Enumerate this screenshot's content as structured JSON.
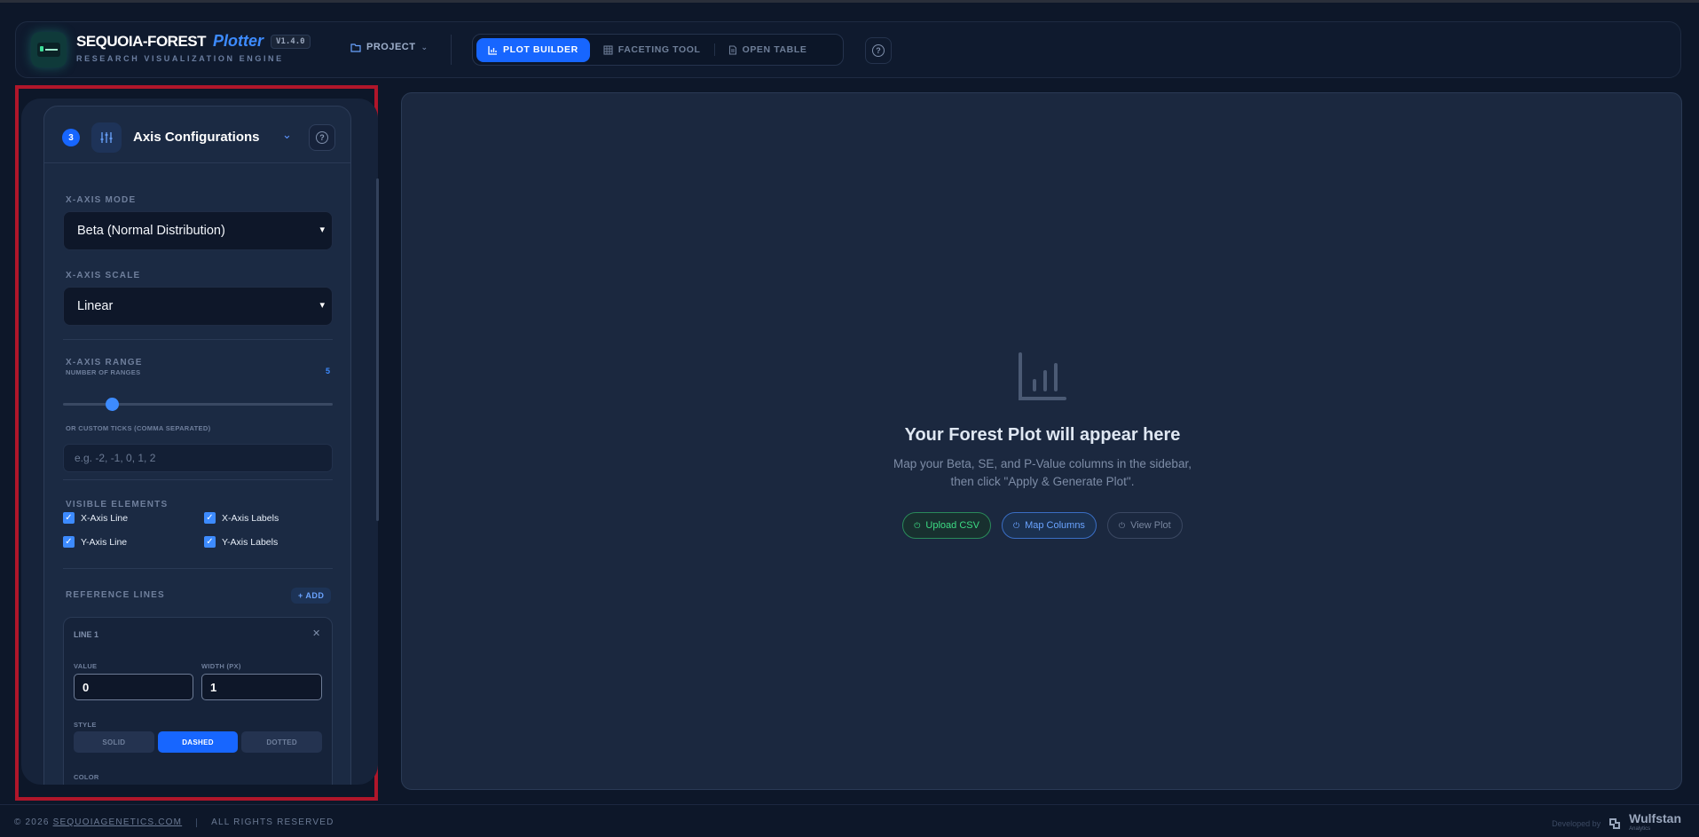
{
  "header": {
    "brand_name": "SEQUOIA-FOREST",
    "brand_sub": "Plotter",
    "version": "V1.4.0",
    "tagline": "RESEARCH VISUALIZATION ENGINE",
    "project_label": "PROJECT",
    "tabs": [
      {
        "label": "PLOT BUILDER",
        "icon": "bar-chart-icon",
        "active": true
      },
      {
        "label": "FACETING TOOL",
        "icon": "grid-icon",
        "active": false
      },
      {
        "label": "OPEN TABLE",
        "icon": "document-icon",
        "active": false
      }
    ]
  },
  "sidebar": {
    "step_number": "3",
    "section_title": "Axis Configurations",
    "x_axis_mode": {
      "label": "X-AXIS MODE",
      "value": "Beta (Normal Distribution)"
    },
    "x_axis_scale": {
      "label": "X-AXIS SCALE",
      "value": "Linear"
    },
    "x_axis_range": {
      "label": "X-AXIS RANGE",
      "count_label": "NUMBER OF RANGES",
      "count_value": "5",
      "slider_fraction": 0.18,
      "custom_label": "OR CUSTOM TICKS (COMMA SEPARATED)",
      "custom_placeholder": "e.g. -2, -1, 0, 1, 2"
    },
    "visible_elements": {
      "label": "VISIBLE ELEMENTS",
      "items": [
        {
          "label": "X-Axis Line",
          "checked": true
        },
        {
          "label": "X-Axis Labels",
          "checked": true
        },
        {
          "label": "Y-Axis Line",
          "checked": true
        },
        {
          "label": "Y-Axis Labels",
          "checked": true
        }
      ]
    },
    "reference_lines": {
      "label": "REFERENCE LINES",
      "add_label": "+ ADD",
      "line": {
        "title": "LINE 1",
        "value_label": "VALUE",
        "value": "0",
        "width_label": "WIDTH (PX)",
        "width": "1",
        "style_label": "STYLE",
        "styles": [
          "SOLID",
          "DASHED",
          "DOTTED"
        ],
        "active_style": "DASHED",
        "color_label": "COLOR"
      }
    }
  },
  "main": {
    "empty_title": "Your Forest Plot will appear here",
    "empty_sub_1": "Map your Beta, SE, and P-Value columns in the sidebar,",
    "empty_sub_2": "then click \"Apply & Generate Plot\".",
    "pills": [
      {
        "label": "Upload CSV",
        "variant": "green"
      },
      {
        "label": "Map Columns",
        "variant": "blue"
      },
      {
        "label": "View Plot",
        "variant": "gray"
      }
    ]
  },
  "footer": {
    "copyright": "© 2026",
    "site": "SEQUOIAGENETICS.COM",
    "rights": "ALL RIGHTS RESERVED",
    "developed_by": "Developed by",
    "company": "Wulfstan",
    "company_sub": "Analytics"
  },
  "colors": {
    "accent": "#1766ff",
    "background": "#0d1729",
    "panel": "#1b283f",
    "highlight_border": "#b0162a"
  }
}
